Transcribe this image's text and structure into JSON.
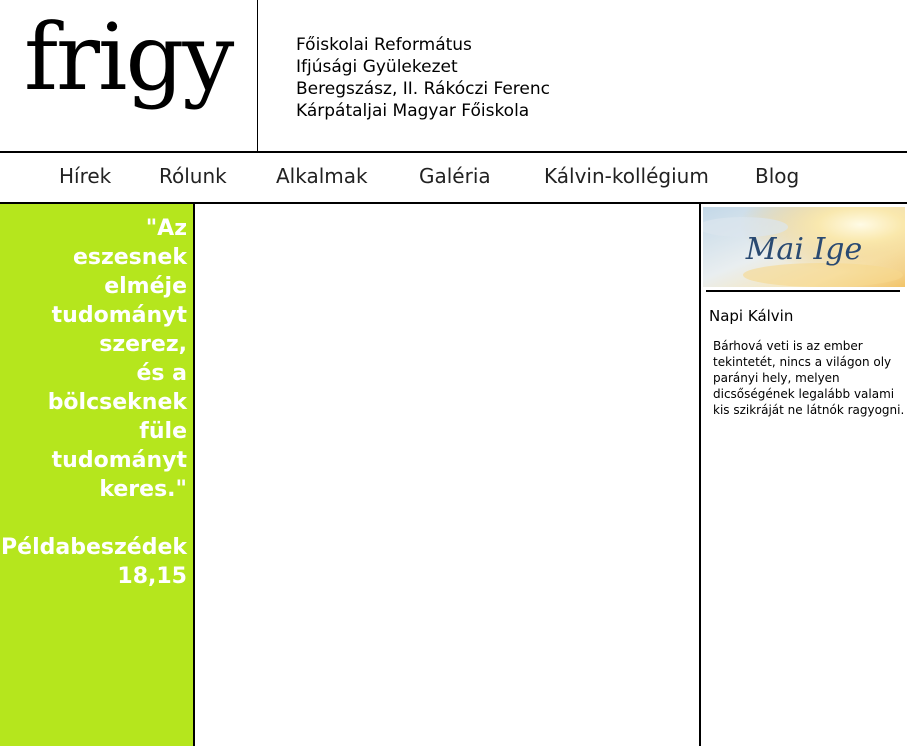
{
  "header": {
    "logo": "frigy",
    "subtitle_lines": [
      "Főiskolai Református",
      "Ifjúsági Gyülekezet",
      "Beregszász, II. Rákóczi Ferenc",
      "Kárpátaljai Magyar Főiskola"
    ]
  },
  "nav": {
    "items": [
      "Hírek",
      "Rólunk",
      "Alkalmak",
      "Galéria",
      "Kálvin-kollégium",
      "Blog"
    ]
  },
  "sidebar_left": {
    "verse_lines": [
      "\"Az",
      "eszesnek",
      "elméje",
      "tudományt",
      "szerez,",
      "és a",
      "bölcseknek",
      "füle",
      "tudományt",
      "keres.\""
    ],
    "reference_lines": [
      "Példabeszédek",
      "18,15"
    ]
  },
  "sidebar_right": {
    "banner_text": "Mai Ige",
    "napi_title": "Napi Kálvin",
    "napi_text": "Bárhová veti is az ember tekintetét, nincs a világon oly parányi hely, melyen dicsőségének legalább valami kis szikráját ne látnók ragyogni."
  },
  "colors": {
    "accent_green": "#b5e61d",
    "nav_text": "#222222"
  }
}
